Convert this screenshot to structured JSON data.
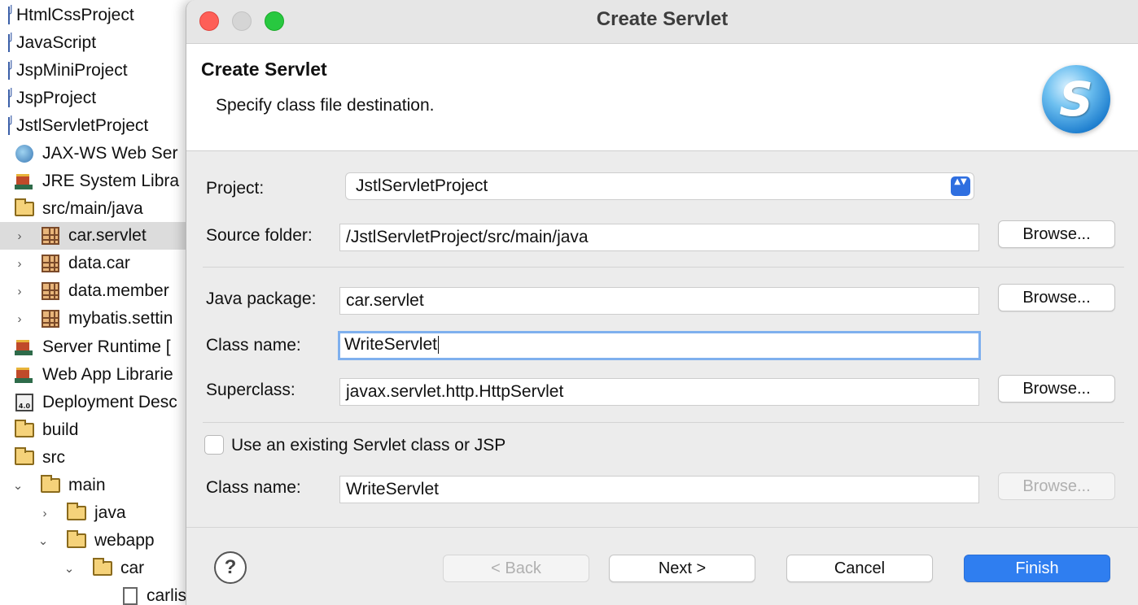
{
  "tree": {
    "items": [
      {
        "label": "HtmlCssProject",
        "icon": "java-project-icon"
      },
      {
        "label": "JavaScript",
        "icon": "java-project-icon"
      },
      {
        "label": "JspMiniProject",
        "icon": "java-project-icon"
      },
      {
        "label": "JspProject",
        "icon": "java-project-icon"
      },
      {
        "label": "JstlServletProject",
        "icon": "java-project-icon"
      },
      {
        "label": "JAX-WS Web Ser",
        "icon": "web-service-icon"
      },
      {
        "label": "JRE System Libra",
        "icon": "library-icon"
      },
      {
        "label": "src/main/java",
        "icon": "source-folder-icon"
      },
      {
        "label": "car.servlet",
        "icon": "package-icon",
        "expander": "›",
        "selected": true
      },
      {
        "label": "data.car",
        "icon": "package-icon",
        "expander": "›"
      },
      {
        "label": "data.member",
        "icon": "package-icon",
        "expander": "›"
      },
      {
        "label": "mybatis.settin",
        "icon": "package-icon",
        "expander": "›"
      },
      {
        "label": "Server Runtime [",
        "icon": "library-icon"
      },
      {
        "label": "Web App Librarie",
        "icon": "library-icon"
      },
      {
        "label": "Deployment Desc",
        "icon": "deployment-descriptor-icon",
        "badge": "4.0"
      },
      {
        "label": "build",
        "icon": "folder-icon"
      },
      {
        "label": "src",
        "icon": "folder-icon"
      },
      {
        "label": "main",
        "icon": "folder-icon",
        "expander": "⌄"
      },
      {
        "label": "java",
        "icon": "folder-icon",
        "expander": "›"
      },
      {
        "label": "webapp",
        "icon": "folder-icon",
        "expander": "⌄"
      },
      {
        "label": "car",
        "icon": "folder-icon",
        "expander": "⌄"
      },
      {
        "label": "carlis",
        "icon": "jsp-file-icon"
      }
    ]
  },
  "dialog": {
    "window_title": "Create Servlet",
    "header_title": "Create Servlet",
    "header_desc": "Specify class file destination.",
    "logo_letter": "S",
    "project_label": "Project:",
    "project_value": "JstlServletProject",
    "select_arrows": "▲▼",
    "source_folder_label": "Source folder:",
    "source_folder_value": "/JstlServletProject/src/main/java",
    "java_package_label": "Java package:",
    "java_package_value": "car.servlet",
    "class_name_label": "Class name:",
    "class_name_value": "WriteServlet",
    "superclass_label": "Superclass:",
    "superclass_value": "javax.servlet.http.HttpServlet",
    "existing_label": "Use an existing Servlet class or JSP",
    "existing_class_name_label": "Class name:",
    "existing_class_name_value": "WriteServlet",
    "browse_label": "Browse...",
    "help_symbol": "?",
    "back_label": "< Back",
    "next_label": "Next >",
    "cancel_label": "Cancel",
    "finish_label": "Finish"
  },
  "colors": {
    "primary_button": "#2f7ef0",
    "focus_ring": "#7fb0ee",
    "close_light": "#fe5f57",
    "zoom_light": "#28c840"
  }
}
